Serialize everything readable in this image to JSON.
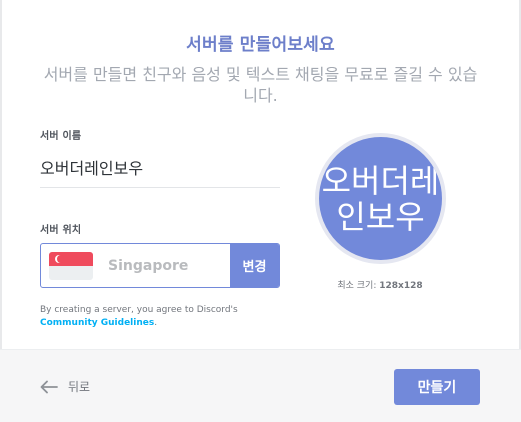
{
  "dialog": {
    "title": "서버를 만들어보세요",
    "subtitle": "서버를 만들면 친구와 음성 및 텍스트 채팅을 무료로 즐길 수 있습니다."
  },
  "server_name": {
    "label": "서버 이름",
    "value": "오버더레인보우"
  },
  "server_region": {
    "label": "서버 위치",
    "value": "Singapore",
    "flag_icon": "singapore-flag-icon",
    "change_label": "변경"
  },
  "terms": {
    "text": "By creating a server, you agree to Discord's",
    "link": "Community Guidelines",
    "suffix": "."
  },
  "icon": {
    "text": "오버더레인보우",
    "size_label": "최소 크기:",
    "size_value": "128x128"
  },
  "footer": {
    "back_label": "뒤로",
    "create_label": "만들기"
  },
  "colors": {
    "accent": "#7289da",
    "title": "#6d7fca",
    "link": "#00b0f4"
  }
}
